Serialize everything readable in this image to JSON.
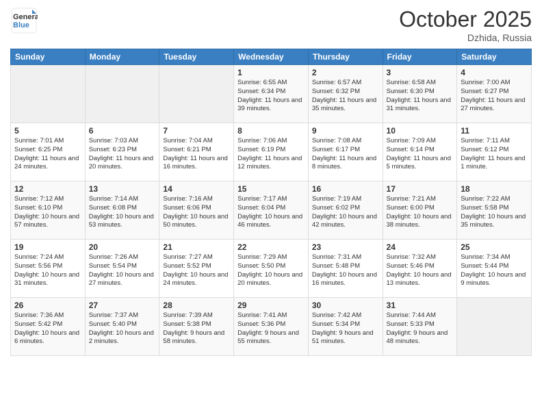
{
  "header": {
    "logo": {
      "general": "General",
      "blue": "Blue"
    },
    "month": "October 2025",
    "location": "Dzhida, Russia"
  },
  "weekdays": [
    "Sunday",
    "Monday",
    "Tuesday",
    "Wednesday",
    "Thursday",
    "Friday",
    "Saturday"
  ],
  "weeks": [
    [
      {
        "day": "",
        "sunrise": "",
        "sunset": "",
        "daylight": "",
        "empty": true
      },
      {
        "day": "",
        "sunrise": "",
        "sunset": "",
        "daylight": "",
        "empty": true
      },
      {
        "day": "",
        "sunrise": "",
        "sunset": "",
        "daylight": "",
        "empty": true
      },
      {
        "day": "1",
        "sunrise": "Sunrise: 6:55 AM",
        "sunset": "Sunset: 6:34 PM",
        "daylight": "Daylight: 11 hours and 39 minutes."
      },
      {
        "day": "2",
        "sunrise": "Sunrise: 6:57 AM",
        "sunset": "Sunset: 6:32 PM",
        "daylight": "Daylight: 11 hours and 35 minutes."
      },
      {
        "day": "3",
        "sunrise": "Sunrise: 6:58 AM",
        "sunset": "Sunset: 6:30 PM",
        "daylight": "Daylight: 11 hours and 31 minutes."
      },
      {
        "day": "4",
        "sunrise": "Sunrise: 7:00 AM",
        "sunset": "Sunset: 6:27 PM",
        "daylight": "Daylight: 11 hours and 27 minutes."
      }
    ],
    [
      {
        "day": "5",
        "sunrise": "Sunrise: 7:01 AM",
        "sunset": "Sunset: 6:25 PM",
        "daylight": "Daylight: 11 hours and 24 minutes."
      },
      {
        "day": "6",
        "sunrise": "Sunrise: 7:03 AM",
        "sunset": "Sunset: 6:23 PM",
        "daylight": "Daylight: 11 hours and 20 minutes."
      },
      {
        "day": "7",
        "sunrise": "Sunrise: 7:04 AM",
        "sunset": "Sunset: 6:21 PM",
        "daylight": "Daylight: 11 hours and 16 minutes."
      },
      {
        "day": "8",
        "sunrise": "Sunrise: 7:06 AM",
        "sunset": "Sunset: 6:19 PM",
        "daylight": "Daylight: 11 hours and 12 minutes."
      },
      {
        "day": "9",
        "sunrise": "Sunrise: 7:08 AM",
        "sunset": "Sunset: 6:17 PM",
        "daylight": "Daylight: 11 hours and 8 minutes."
      },
      {
        "day": "10",
        "sunrise": "Sunrise: 7:09 AM",
        "sunset": "Sunset: 6:14 PM",
        "daylight": "Daylight: 11 hours and 5 minutes."
      },
      {
        "day": "11",
        "sunrise": "Sunrise: 7:11 AM",
        "sunset": "Sunset: 6:12 PM",
        "daylight": "Daylight: 11 hours and 1 minute."
      }
    ],
    [
      {
        "day": "12",
        "sunrise": "Sunrise: 7:12 AM",
        "sunset": "Sunset: 6:10 PM",
        "daylight": "Daylight: 10 hours and 57 minutes."
      },
      {
        "day": "13",
        "sunrise": "Sunrise: 7:14 AM",
        "sunset": "Sunset: 6:08 PM",
        "daylight": "Daylight: 10 hours and 53 minutes."
      },
      {
        "day": "14",
        "sunrise": "Sunrise: 7:16 AM",
        "sunset": "Sunset: 6:06 PM",
        "daylight": "Daylight: 10 hours and 50 minutes."
      },
      {
        "day": "15",
        "sunrise": "Sunrise: 7:17 AM",
        "sunset": "Sunset: 6:04 PM",
        "daylight": "Daylight: 10 hours and 46 minutes."
      },
      {
        "day": "16",
        "sunrise": "Sunrise: 7:19 AM",
        "sunset": "Sunset: 6:02 PM",
        "daylight": "Daylight: 10 hours and 42 minutes."
      },
      {
        "day": "17",
        "sunrise": "Sunrise: 7:21 AM",
        "sunset": "Sunset: 6:00 PM",
        "daylight": "Daylight: 10 hours and 38 minutes."
      },
      {
        "day": "18",
        "sunrise": "Sunrise: 7:22 AM",
        "sunset": "Sunset: 5:58 PM",
        "daylight": "Daylight: 10 hours and 35 minutes."
      }
    ],
    [
      {
        "day": "19",
        "sunrise": "Sunrise: 7:24 AM",
        "sunset": "Sunset: 5:56 PM",
        "daylight": "Daylight: 10 hours and 31 minutes."
      },
      {
        "day": "20",
        "sunrise": "Sunrise: 7:26 AM",
        "sunset": "Sunset: 5:54 PM",
        "daylight": "Daylight: 10 hours and 27 minutes."
      },
      {
        "day": "21",
        "sunrise": "Sunrise: 7:27 AM",
        "sunset": "Sunset: 5:52 PM",
        "daylight": "Daylight: 10 hours and 24 minutes."
      },
      {
        "day": "22",
        "sunrise": "Sunrise: 7:29 AM",
        "sunset": "Sunset: 5:50 PM",
        "daylight": "Daylight: 10 hours and 20 minutes."
      },
      {
        "day": "23",
        "sunrise": "Sunrise: 7:31 AM",
        "sunset": "Sunset: 5:48 PM",
        "daylight": "Daylight: 10 hours and 16 minutes."
      },
      {
        "day": "24",
        "sunrise": "Sunrise: 7:32 AM",
        "sunset": "Sunset: 5:46 PM",
        "daylight": "Daylight: 10 hours and 13 minutes."
      },
      {
        "day": "25",
        "sunrise": "Sunrise: 7:34 AM",
        "sunset": "Sunset: 5:44 PM",
        "daylight": "Daylight: 10 hours and 9 minutes."
      }
    ],
    [
      {
        "day": "26",
        "sunrise": "Sunrise: 7:36 AM",
        "sunset": "Sunset: 5:42 PM",
        "daylight": "Daylight: 10 hours and 6 minutes."
      },
      {
        "day": "27",
        "sunrise": "Sunrise: 7:37 AM",
        "sunset": "Sunset: 5:40 PM",
        "daylight": "Daylight: 10 hours and 2 minutes."
      },
      {
        "day": "28",
        "sunrise": "Sunrise: 7:39 AM",
        "sunset": "Sunset: 5:38 PM",
        "daylight": "Daylight: 9 hours and 58 minutes."
      },
      {
        "day": "29",
        "sunrise": "Sunrise: 7:41 AM",
        "sunset": "Sunset: 5:36 PM",
        "daylight": "Daylight: 9 hours and 55 minutes."
      },
      {
        "day": "30",
        "sunrise": "Sunrise: 7:42 AM",
        "sunset": "Sunset: 5:34 PM",
        "daylight": "Daylight: 9 hours and 51 minutes."
      },
      {
        "day": "31",
        "sunrise": "Sunrise: 7:44 AM",
        "sunset": "Sunset: 5:33 PM",
        "daylight": "Daylight: 9 hours and 48 minutes."
      },
      {
        "day": "",
        "sunrise": "",
        "sunset": "",
        "daylight": "",
        "empty": true
      }
    ]
  ]
}
